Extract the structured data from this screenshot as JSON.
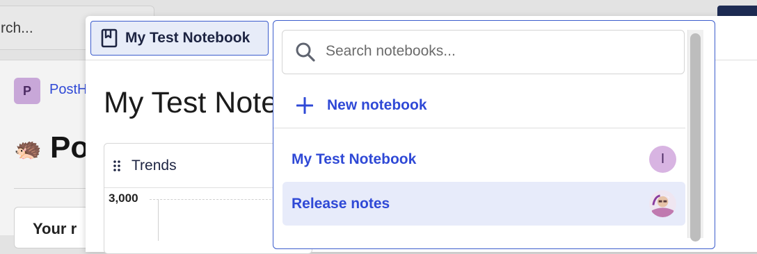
{
  "background": {
    "search_placeholder": "rch...",
    "project_avatar_letter": "P",
    "project_link": "PostH",
    "page_emoji": "🦔",
    "page_heading": "Po",
    "card_text": "Your r"
  },
  "notebook": {
    "button_label": "My Test Notebook",
    "title": "My Test Note",
    "trends_card": {
      "title": "Trends",
      "y_tick_top": "3,000"
    }
  },
  "dropdown": {
    "search_placeholder": "Search notebooks...",
    "new_notebook_label": "New notebook",
    "items": [
      {
        "label": "My Test Notebook",
        "avatar_initial": "I",
        "selected": false
      },
      {
        "label": "Release notes",
        "avatar_type": "photo",
        "selected": true
      }
    ]
  },
  "colors": {
    "accent": "#2f49d6",
    "selected_row": "#e7ebfa",
    "avatar_purple": "#d8b4e2"
  },
  "icons": [
    "book-icon",
    "search-icon",
    "plus-icon",
    "drag-handle-icon"
  ]
}
